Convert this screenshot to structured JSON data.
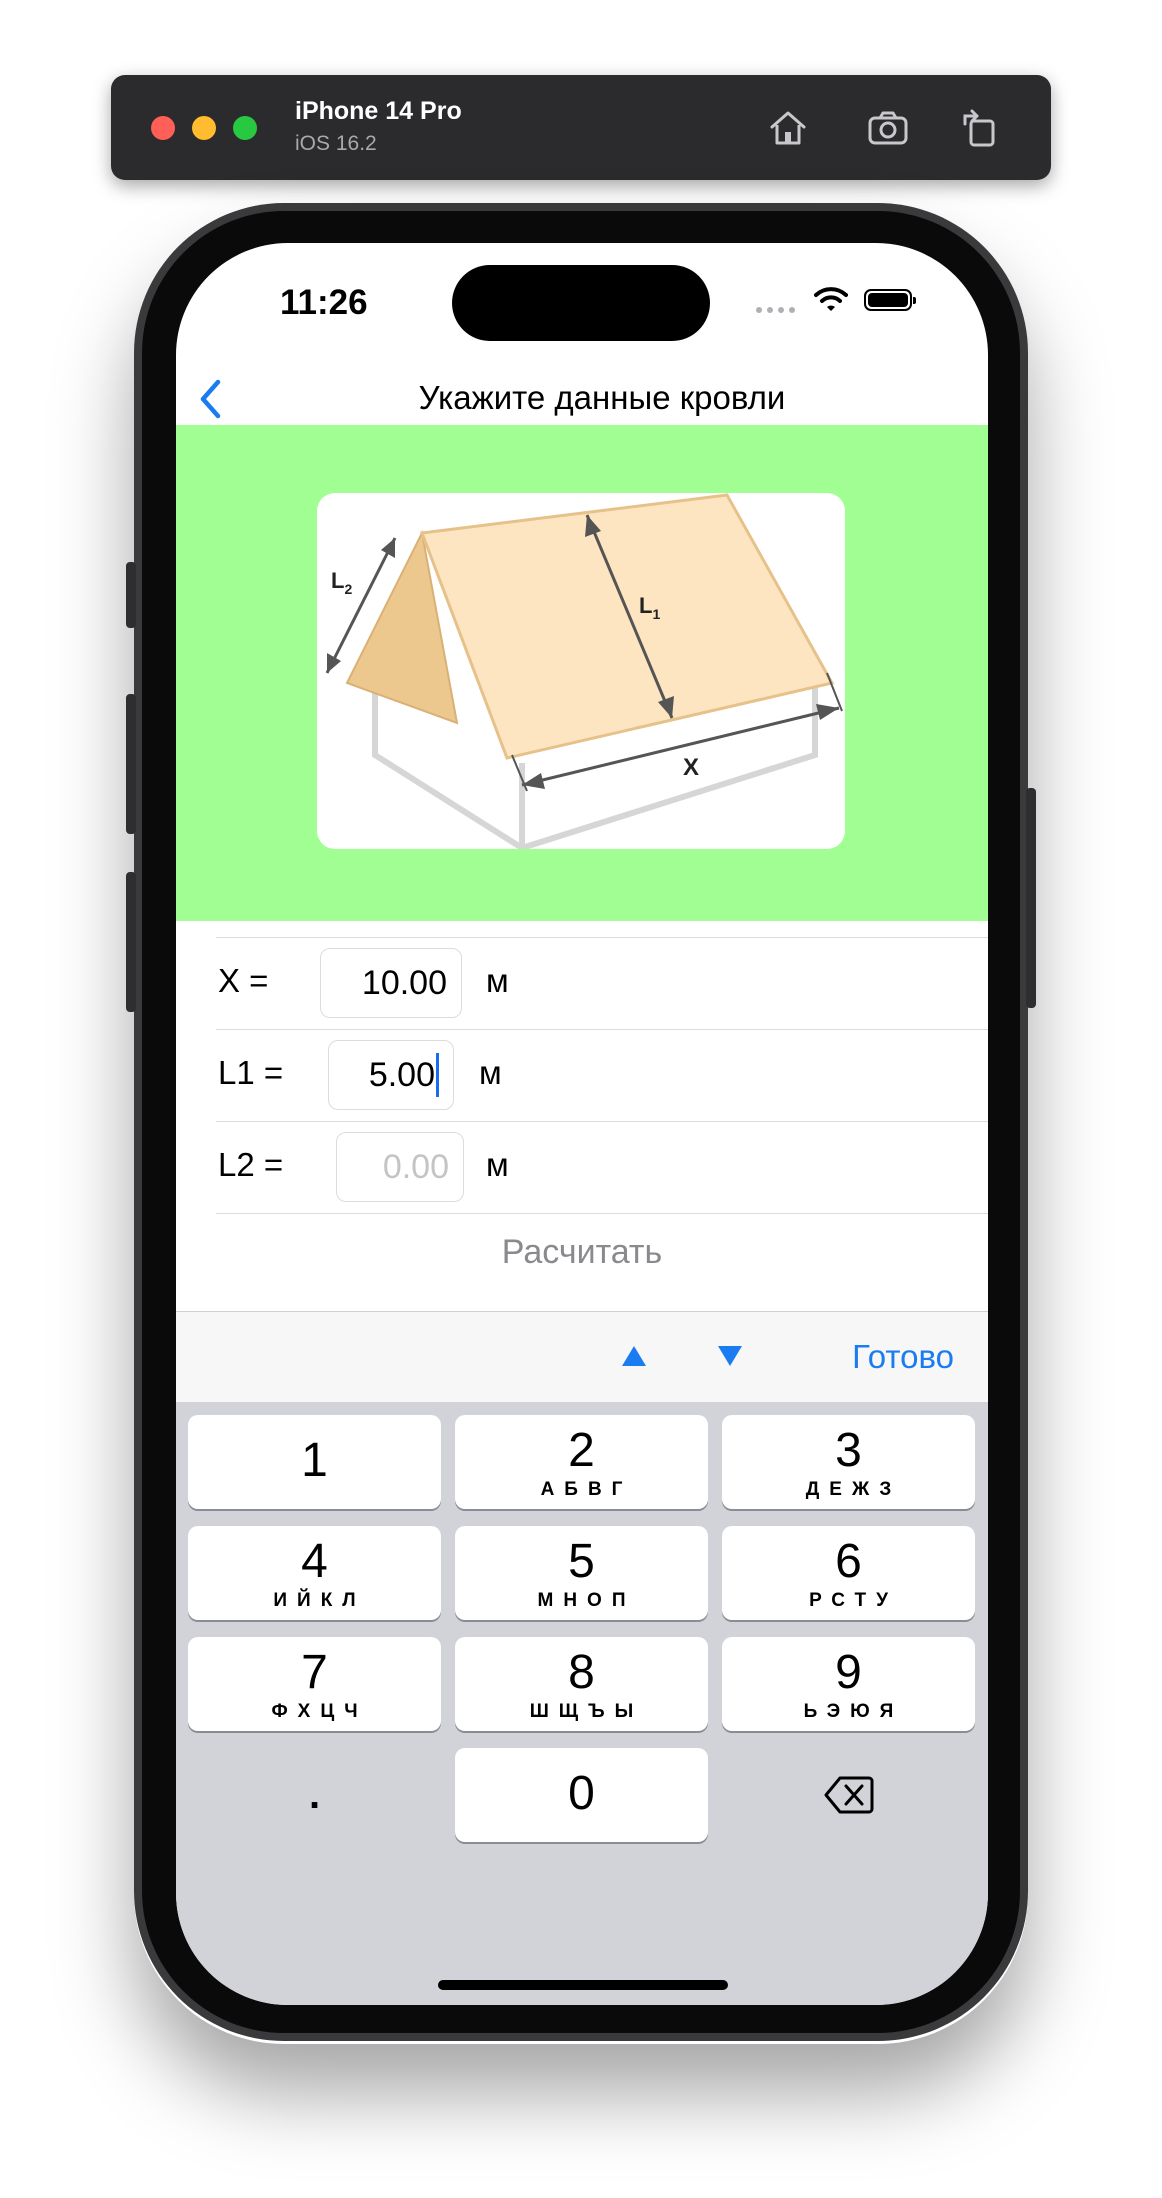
{
  "simulator": {
    "device_name": "iPhone 14 Pro",
    "os_version": "iOS 16.2",
    "icons": [
      "home-icon",
      "screenshot-icon",
      "rotate-icon"
    ]
  },
  "status_bar": {
    "time": "11:26"
  },
  "nav": {
    "title": "Укажите данные кровли",
    "back_icon": "chevron-left-icon"
  },
  "diagram": {
    "labels": {
      "l2": "L",
      "l2_sub": "2",
      "l1": "L",
      "l1_sub": "1",
      "x": "X"
    }
  },
  "form": {
    "rows": [
      {
        "label": "X  =",
        "value": "10.00",
        "placeholder": "",
        "unit": "м"
      },
      {
        "label": "L1  =",
        "value": "5.00",
        "placeholder": "",
        "unit": "м"
      },
      {
        "label": "L2  =",
        "value": "",
        "placeholder": "0.00",
        "unit": "м"
      }
    ],
    "calculate_label": "Расчитать"
  },
  "keyboard_toolbar": {
    "up_icon": "triangle-up-icon",
    "down_icon": "triangle-down-icon",
    "done_label": "Готово"
  },
  "keypad": {
    "keys": [
      {
        "num": "1",
        "letters": ""
      },
      {
        "num": "2",
        "letters": "АБВГ"
      },
      {
        "num": "3",
        "letters": "ДЕЖЗ"
      },
      {
        "num": "4",
        "letters": "ИЙКЛ"
      },
      {
        "num": "5",
        "letters": "МНОП"
      },
      {
        "num": "6",
        "letters": "РСТУ"
      },
      {
        "num": "7",
        "letters": "ФХЦЧ"
      },
      {
        "num": "8",
        "letters": "ШЩЪЫ"
      },
      {
        "num": "9",
        "letters": "ЬЭЮЯ"
      }
    ],
    "decimal": ".",
    "zero": "0",
    "delete_icon": "backspace-icon"
  },
  "colors": {
    "accent": "#1a7cf0",
    "panel_green": "#a1fe92",
    "roof": "#fde5c1",
    "keyboard_bg": "#d1d3d9"
  }
}
